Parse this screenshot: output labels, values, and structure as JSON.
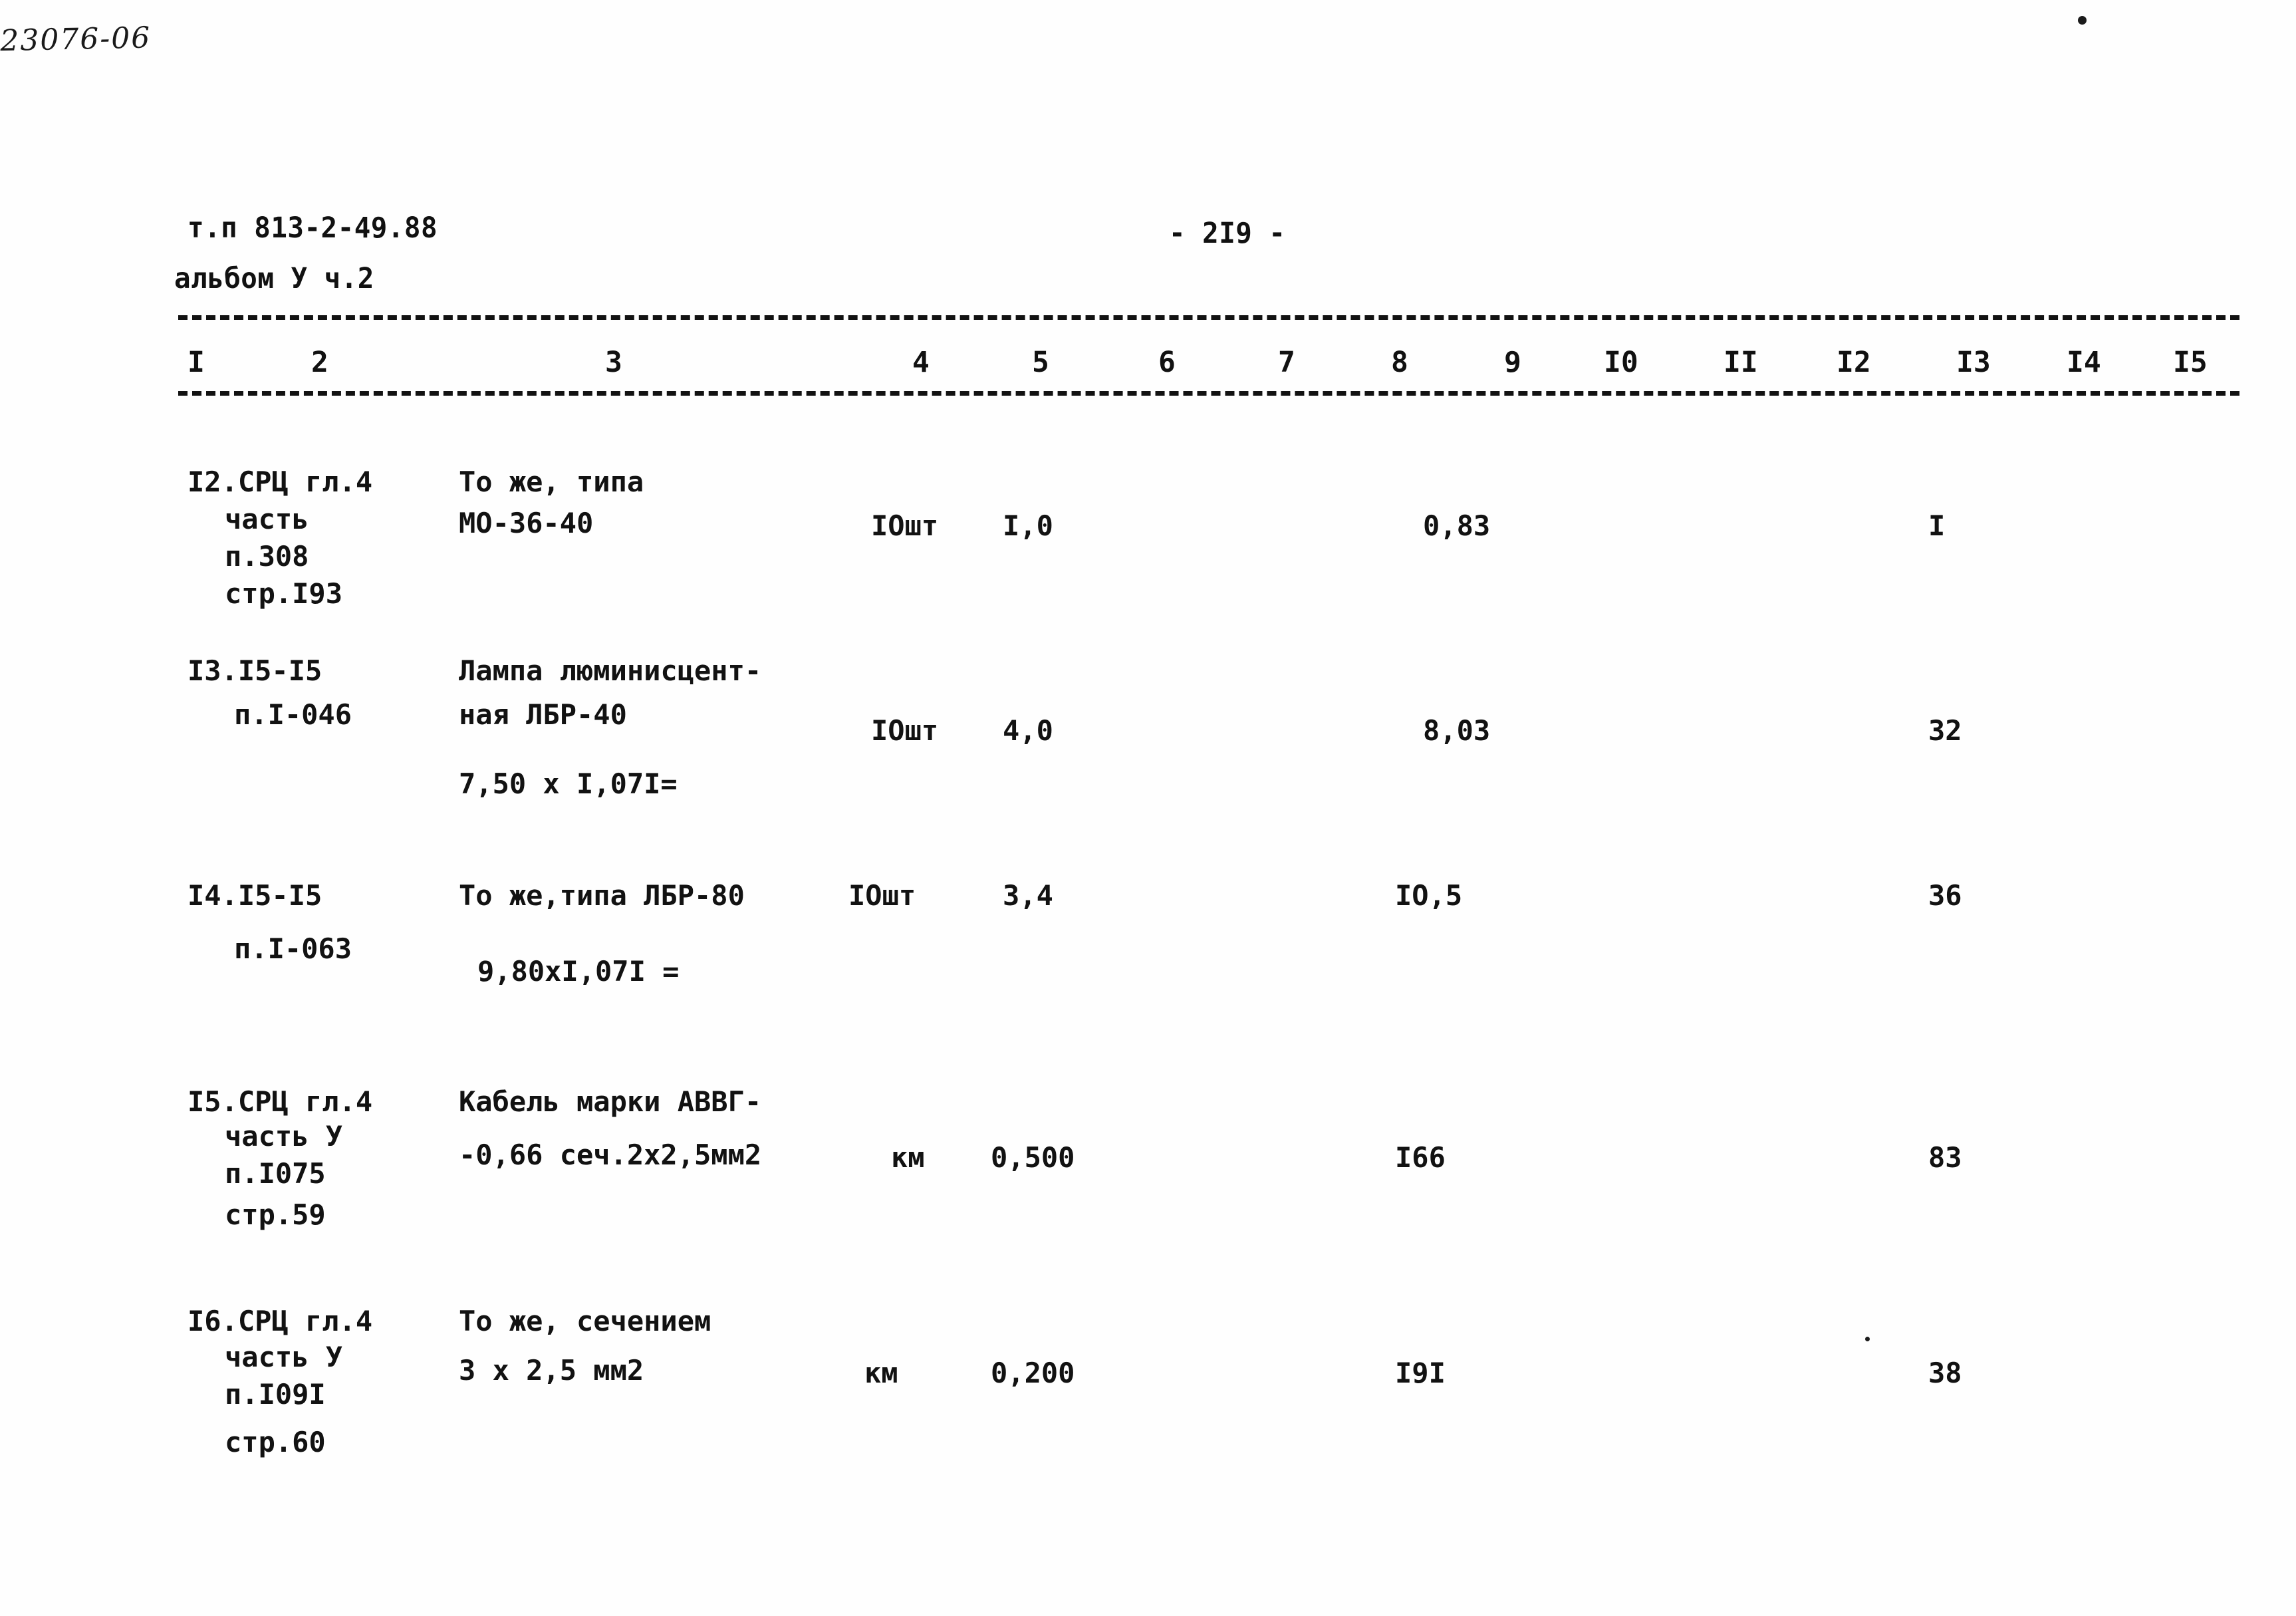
{
  "header": {
    "doc_code": "т.п 813-2-49.88",
    "album_line": "альбом У ч.2",
    "page_number": "- 2I9 -",
    "stamp_code": "23076-06"
  },
  "table": {
    "column_headers": [
      "I",
      "2",
      "3",
      "4",
      "5",
      "6",
      "7",
      "8",
      "9",
      "I0",
      "II",
      "I2",
      "I3",
      "I4",
      "I5"
    ],
    "rows": [
      {
        "ref_lines": [
          "I2.СРЦ гл.4",
          "часть",
          "п.308",
          "стр.I93"
        ],
        "desc_lines": [
          "То же, типа",
          "МО-36-40"
        ],
        "calc": "",
        "unit": "IОшт",
        "qty": "I,0",
        "price": "0,83",
        "total": "I"
      },
      {
        "ref_lines": [
          "I3.I5-I5",
          "п.I-046"
        ],
        "desc_lines": [
          "Лампа люминисцент-",
          "ная ЛБР-40"
        ],
        "calc": "7,50 x I,07I=",
        "unit": "IОшт",
        "qty": "4,0",
        "price": "8,03",
        "total": "32"
      },
      {
        "ref_lines": [
          "I4.I5-I5",
          "п.I-063"
        ],
        "desc_lines": [
          "То же,типа ЛБР-80"
        ],
        "calc": "9,80xI,07I =",
        "unit": "IОшт",
        "qty": "3,4",
        "price": "IО,5",
        "total": "36"
      },
      {
        "ref_lines": [
          "I5.СРЦ гл.4",
          "часть У",
          "п.I075",
          "стр.59"
        ],
        "desc_lines": [
          "Кабель марки АВВГ-",
          "-0,66 сеч.2х2,5мм2"
        ],
        "calc": "",
        "unit": "км",
        "qty": "0,500",
        "price": "I66",
        "total": "83"
      },
      {
        "ref_lines": [
          "I6.СРЦ гл.4",
          "часть У",
          "п.I09I",
          "стр.60"
        ],
        "desc_lines": [
          "То же, сечением",
          "3 х 2,5 мм2"
        ],
        "calc": "",
        "unit": "км",
        "qty": "0,200",
        "price": "I9I",
        "total": "38"
      }
    ]
  }
}
